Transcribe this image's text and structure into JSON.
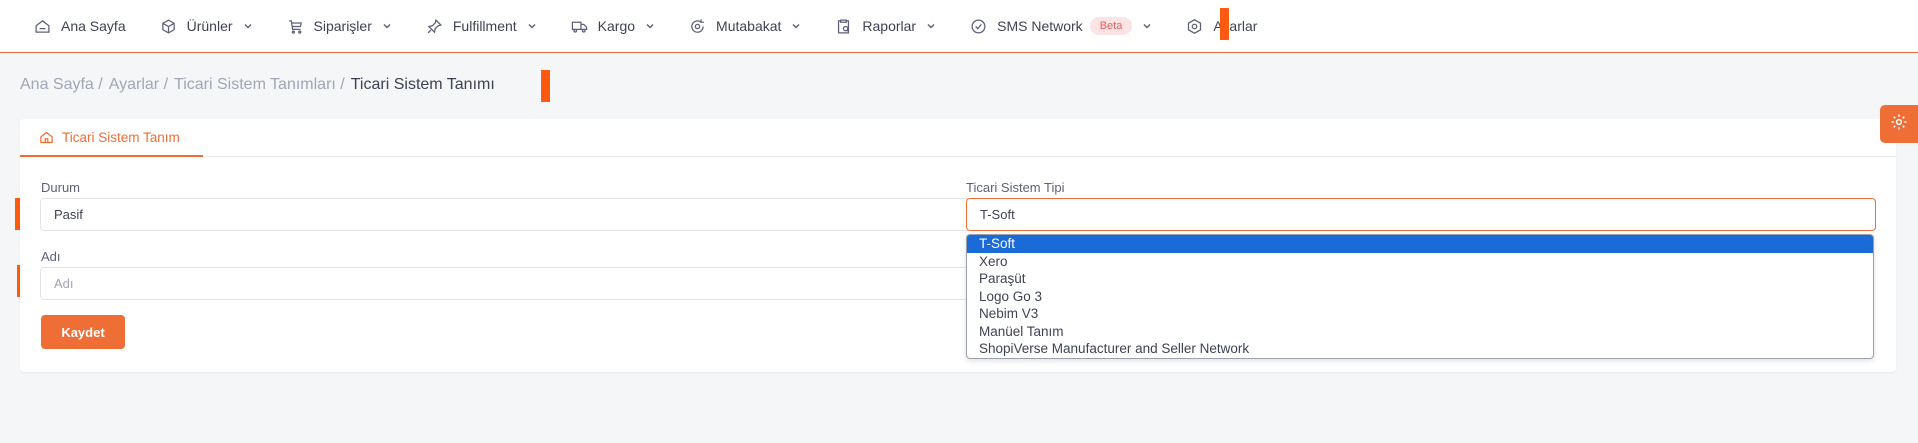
{
  "nav": {
    "items": [
      {
        "label": "Ana Sayfa",
        "icon": "home-icon",
        "has_dropdown": false
      },
      {
        "label": "Ürünler",
        "icon": "box-icon",
        "has_dropdown": true
      },
      {
        "label": "Siparişler",
        "icon": "cart-icon",
        "has_dropdown": true
      },
      {
        "label": "Fulfillment",
        "icon": "pin-icon",
        "has_dropdown": true
      },
      {
        "label": "Kargo",
        "icon": "truck-icon",
        "has_dropdown": true
      },
      {
        "label": "Mutabakat",
        "icon": "sync-icon",
        "has_dropdown": true
      },
      {
        "label": "Raporlar",
        "icon": "clipboard-icon",
        "has_dropdown": true
      },
      {
        "label": "SMS Network",
        "icon": "check-circle-icon",
        "has_dropdown": true,
        "badge": "Beta"
      },
      {
        "label": "Ayarlar",
        "icon": "hexagon-gear-icon",
        "has_dropdown": false
      }
    ]
  },
  "breadcrumb": {
    "items": [
      "Ana Sayfa",
      "Ayarlar",
      "Ticari Sistem Tanımları"
    ],
    "separator": "/",
    "current": "Ticari Sistem Tanımı"
  },
  "card": {
    "tab_label": "Ticari Sistem Tanım",
    "status": {
      "label": "Durum",
      "value": "Pasif"
    },
    "system_type": {
      "label": "Ticari Sistem Tipi",
      "value": "T-Soft"
    },
    "name": {
      "label": "Adı",
      "value": "",
      "placeholder": "Adı"
    },
    "save_label": "Kaydet"
  },
  "dropdown": {
    "options": [
      "T-Soft",
      "Xero",
      "Paraşüt",
      "Logo Go 3",
      "Nebim V3",
      "Manüel Tanım",
      "ShopiVerse Manufacturer and Seller Network"
    ],
    "selected": "T-Soft"
  },
  "colors": {
    "accent": "#ee6e35",
    "selection": "#1a6ad8",
    "marker": "#ff5a0f"
  }
}
